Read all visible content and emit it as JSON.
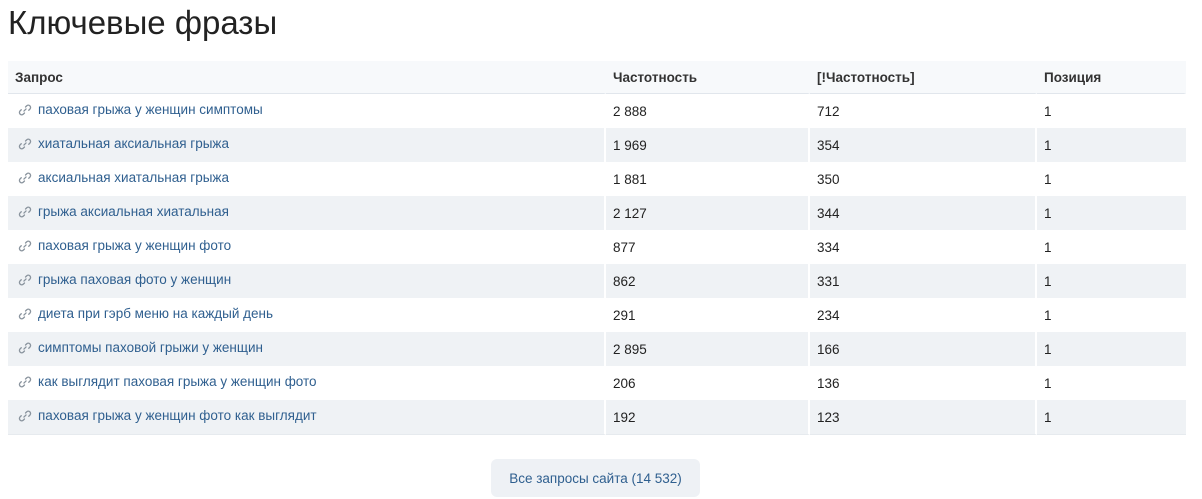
{
  "page": {
    "title": "Ключевые фразы"
  },
  "table": {
    "headers": {
      "query": "Запрос",
      "frequency": "Частотность",
      "exact_frequency": "[!Частотность]",
      "position": "Позиция"
    },
    "rows": [
      {
        "query": "паховая грыжа у женщин симптомы",
        "frequency": "2 888",
        "exact_frequency": "712",
        "position": "1"
      },
      {
        "query": "хиатальная аксиальная грыжа",
        "frequency": "1 969",
        "exact_frequency": "354",
        "position": "1"
      },
      {
        "query": "аксиальная хиатальная грыжа",
        "frequency": "1 881",
        "exact_frequency": "350",
        "position": "1"
      },
      {
        "query": "грыжа аксиальная хиатальная",
        "frequency": "2 127",
        "exact_frequency": "344",
        "position": "1"
      },
      {
        "query": "паховая грыжа у женщин фото",
        "frequency": "877",
        "exact_frequency": "334",
        "position": "1"
      },
      {
        "query": "грыжа паховая фото у женщин",
        "frequency": "862",
        "exact_frequency": "331",
        "position": "1"
      },
      {
        "query": "диета при гэрб меню на каждый день",
        "frequency": "291",
        "exact_frequency": "234",
        "position": "1"
      },
      {
        "query": "симптомы паховой грыжи у женщин",
        "frequency": "2 895",
        "exact_frequency": "166",
        "position": "1"
      },
      {
        "query": "как выглядит паховая грыжа у женщин фото",
        "frequency": "206",
        "exact_frequency": "136",
        "position": "1"
      },
      {
        "query": "паховая грыжа у женщин фото как выглядит",
        "frequency": "192",
        "exact_frequency": "123",
        "position": "1"
      }
    ],
    "row_icon": "link-icon"
  },
  "footer": {
    "all_queries_label": "Все запросы сайта (14 532)"
  },
  "colors": {
    "link": "#2f5f8f",
    "row_stripe": "#eff2f5",
    "header_bg": "#f7f9fb",
    "button_bg": "#eef1f5"
  }
}
